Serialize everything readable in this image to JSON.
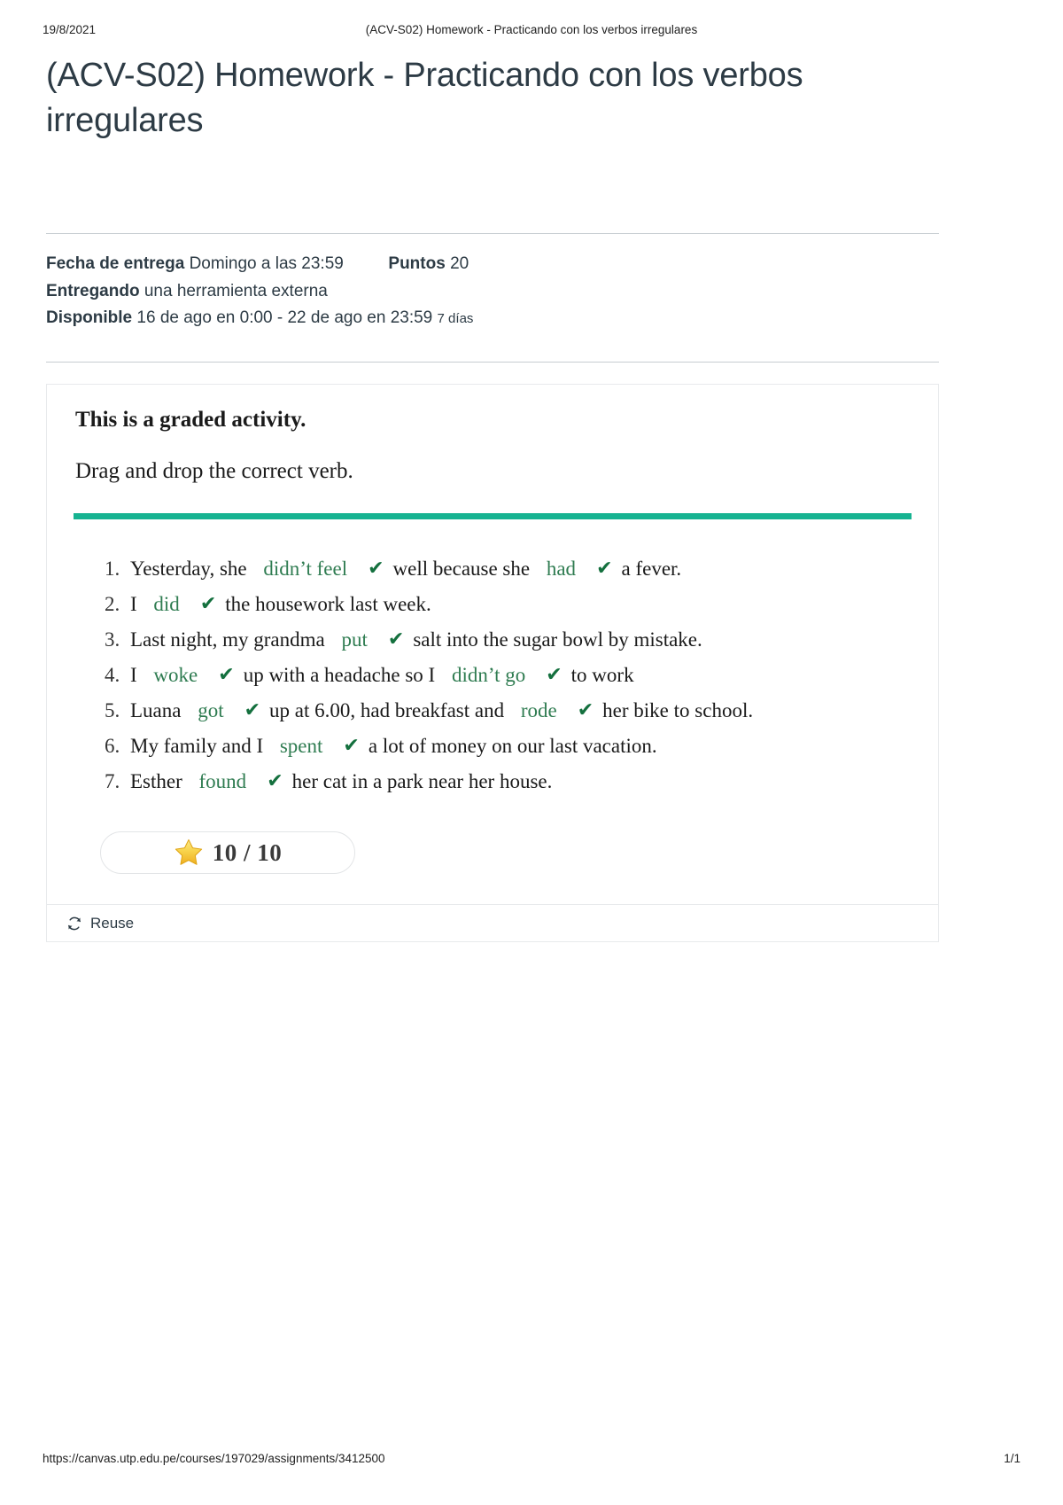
{
  "print_header": {
    "date": "19/8/2021",
    "title": "(ACV-S02) Homework - Practicando con los verbos irregulares"
  },
  "assignment": {
    "title": "(ACV-S02) Homework - Practicando con los verbos irregulares"
  },
  "meta": {
    "due_label": "Fecha de entrega",
    "due_value": "Domingo a las 23:59",
    "points_label": "Puntos",
    "points_value": "20",
    "submitting_label": "Entregando",
    "submitting_value": "una herramienta externa",
    "available_label": "Disponible",
    "available_value": "16 de ago en 0:00 - 22 de ago en 23:59",
    "available_duration": "7 días"
  },
  "activity": {
    "graded_heading": "This is a graded activity.",
    "instruction": "Drag and drop the correct verb.",
    "divider_color": "#16b391",
    "answer_color": "#2f7c51",
    "check_color": "#14703e",
    "check_glyph": "✔",
    "exercises": [
      {
        "number": "1.",
        "parts": [
          {
            "type": "text",
            "text": "Yesterday, she"
          },
          {
            "type": "answer",
            "text": "didn’t feel"
          },
          {
            "type": "check"
          },
          {
            "type": "text",
            "text": "well because she"
          },
          {
            "type": "answer",
            "text": "had"
          },
          {
            "type": "check"
          },
          {
            "type": "text",
            "text": "a fever."
          }
        ]
      },
      {
        "number": "2.",
        "parts": [
          {
            "type": "text",
            "text": "I"
          },
          {
            "type": "answer",
            "text": "did"
          },
          {
            "type": "check"
          },
          {
            "type": "text",
            "text": "the housework last week."
          }
        ]
      },
      {
        "number": "3.",
        "parts": [
          {
            "type": "text",
            "text": "Last night, my grandma"
          },
          {
            "type": "answer",
            "text": "put"
          },
          {
            "type": "check"
          },
          {
            "type": "text",
            "text": "salt into the sugar bowl by mistake."
          }
        ]
      },
      {
        "number": "4.",
        "parts": [
          {
            "type": "text",
            "text": "I"
          },
          {
            "type": "answer",
            "text": "woke"
          },
          {
            "type": "check"
          },
          {
            "type": "text",
            "text": "up with a headache so I"
          },
          {
            "type": "answer",
            "text": "didn’t go"
          },
          {
            "type": "check"
          },
          {
            "type": "text",
            "text": "to work"
          }
        ]
      },
      {
        "number": "5.",
        "parts": [
          {
            "type": "text",
            "text": "Luana"
          },
          {
            "type": "answer",
            "text": "got"
          },
          {
            "type": "check"
          },
          {
            "type": "text",
            "text": "up at 6.00, had breakfast and"
          },
          {
            "type": "answer",
            "text": "rode"
          },
          {
            "type": "check"
          },
          {
            "type": "text",
            "text": "her bike to school."
          }
        ]
      },
      {
        "number": "6.",
        "parts": [
          {
            "type": "text",
            "text": "My family and I"
          },
          {
            "type": "answer",
            "text": "spent"
          },
          {
            "type": "check"
          },
          {
            "type": "text",
            "text": "a lot of money on our last vacation."
          }
        ]
      },
      {
        "number": "7.",
        "parts": [
          {
            "type": "text",
            "text": "Esther"
          },
          {
            "type": "answer",
            "text": "found"
          },
          {
            "type": "check"
          },
          {
            "type": "text",
            "text": "her cat in a park near her house."
          }
        ]
      }
    ],
    "score": {
      "icon": "star-icon",
      "value": "10 / 10"
    },
    "reuse_label": "Reuse"
  },
  "print_footer": {
    "url": "https://canvas.utp.edu.pe/courses/197029/assignments/3412500",
    "page": "1/1"
  }
}
